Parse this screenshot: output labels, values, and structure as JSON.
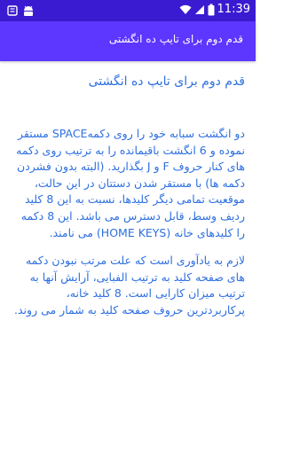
{
  "status_bar": {
    "time": "11:39",
    "colors": {
      "background": "#3a1bd1"
    },
    "icons": [
      "notification-icon",
      "android-icon",
      "wifi-icon",
      "signal-icon",
      "battery-icon"
    ]
  },
  "app_bar": {
    "title": "قدم دوم برای تایپ ده انگشتی",
    "colors": {
      "background": "#5d36ff",
      "text": "#ffffff"
    }
  },
  "content": {
    "heading": "قدم دوم برای تایپ ده انگشتی",
    "paragraphs": [
      "دو انگشت سبابه خود را روی دکمهSPACE مستقر نموده و 6 انگشت باقیمانده را به ترتیب روی دکمه های کنار حروف F و J بگذارید. (البته بدون فشردن دکمه ها) با مستقر شدن دستتان در این حالت، موقعیت تمامی دیگر کلیدها، نسبت به این 8 کلید ردیف وسط، قابل دسترس می باشد. این 8 دکمه را کلیدهای خانه (HOME KEYS) می نامند.",
      "لازم به یادآوری است که علت مرتب نبودن دکمه های صفحه کلید به ترتیب الفبایی، آرایش آنها به ترتیب میزان کارایی است. 8 کلید خانه، پرکاربردترین حروف صفحه کلید به شمار می روند."
    ],
    "colors": {
      "text": "#2d6fe0"
    }
  }
}
